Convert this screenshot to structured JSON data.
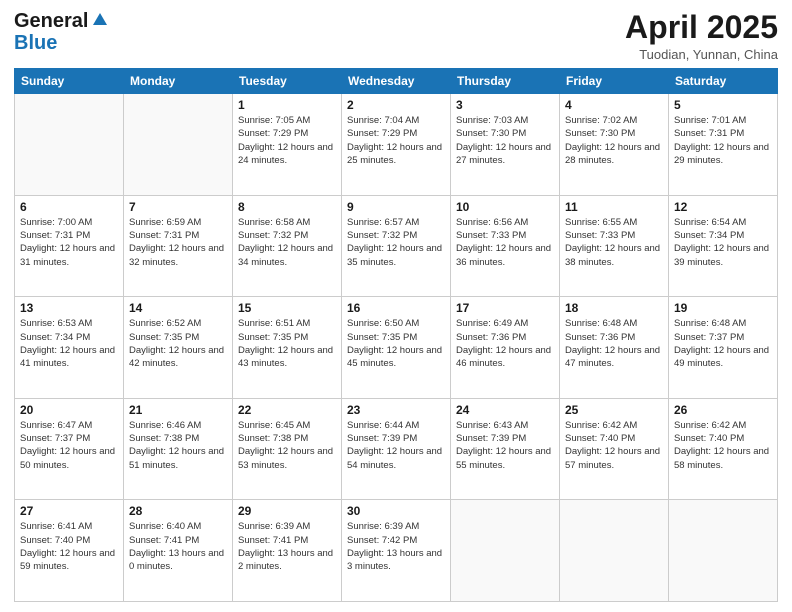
{
  "header": {
    "logo_general": "General",
    "logo_blue": "Blue",
    "title": "April 2025",
    "subtitle": "Tuodian, Yunnan, China"
  },
  "days_of_week": [
    "Sunday",
    "Monday",
    "Tuesday",
    "Wednesday",
    "Thursday",
    "Friday",
    "Saturday"
  ],
  "weeks": [
    [
      {
        "day": "",
        "info": ""
      },
      {
        "day": "",
        "info": ""
      },
      {
        "day": "1",
        "info": "Sunrise: 7:05 AM\nSunset: 7:29 PM\nDaylight: 12 hours and 24 minutes."
      },
      {
        "day": "2",
        "info": "Sunrise: 7:04 AM\nSunset: 7:29 PM\nDaylight: 12 hours and 25 minutes."
      },
      {
        "day": "3",
        "info": "Sunrise: 7:03 AM\nSunset: 7:30 PM\nDaylight: 12 hours and 27 minutes."
      },
      {
        "day": "4",
        "info": "Sunrise: 7:02 AM\nSunset: 7:30 PM\nDaylight: 12 hours and 28 minutes."
      },
      {
        "day": "5",
        "info": "Sunrise: 7:01 AM\nSunset: 7:31 PM\nDaylight: 12 hours and 29 minutes."
      }
    ],
    [
      {
        "day": "6",
        "info": "Sunrise: 7:00 AM\nSunset: 7:31 PM\nDaylight: 12 hours and 31 minutes."
      },
      {
        "day": "7",
        "info": "Sunrise: 6:59 AM\nSunset: 7:31 PM\nDaylight: 12 hours and 32 minutes."
      },
      {
        "day": "8",
        "info": "Sunrise: 6:58 AM\nSunset: 7:32 PM\nDaylight: 12 hours and 34 minutes."
      },
      {
        "day": "9",
        "info": "Sunrise: 6:57 AM\nSunset: 7:32 PM\nDaylight: 12 hours and 35 minutes."
      },
      {
        "day": "10",
        "info": "Sunrise: 6:56 AM\nSunset: 7:33 PM\nDaylight: 12 hours and 36 minutes."
      },
      {
        "day": "11",
        "info": "Sunrise: 6:55 AM\nSunset: 7:33 PM\nDaylight: 12 hours and 38 minutes."
      },
      {
        "day": "12",
        "info": "Sunrise: 6:54 AM\nSunset: 7:34 PM\nDaylight: 12 hours and 39 minutes."
      }
    ],
    [
      {
        "day": "13",
        "info": "Sunrise: 6:53 AM\nSunset: 7:34 PM\nDaylight: 12 hours and 41 minutes."
      },
      {
        "day": "14",
        "info": "Sunrise: 6:52 AM\nSunset: 7:35 PM\nDaylight: 12 hours and 42 minutes."
      },
      {
        "day": "15",
        "info": "Sunrise: 6:51 AM\nSunset: 7:35 PM\nDaylight: 12 hours and 43 minutes."
      },
      {
        "day": "16",
        "info": "Sunrise: 6:50 AM\nSunset: 7:35 PM\nDaylight: 12 hours and 45 minutes."
      },
      {
        "day": "17",
        "info": "Sunrise: 6:49 AM\nSunset: 7:36 PM\nDaylight: 12 hours and 46 minutes."
      },
      {
        "day": "18",
        "info": "Sunrise: 6:48 AM\nSunset: 7:36 PM\nDaylight: 12 hours and 47 minutes."
      },
      {
        "day": "19",
        "info": "Sunrise: 6:48 AM\nSunset: 7:37 PM\nDaylight: 12 hours and 49 minutes."
      }
    ],
    [
      {
        "day": "20",
        "info": "Sunrise: 6:47 AM\nSunset: 7:37 PM\nDaylight: 12 hours and 50 minutes."
      },
      {
        "day": "21",
        "info": "Sunrise: 6:46 AM\nSunset: 7:38 PM\nDaylight: 12 hours and 51 minutes."
      },
      {
        "day": "22",
        "info": "Sunrise: 6:45 AM\nSunset: 7:38 PM\nDaylight: 12 hours and 53 minutes."
      },
      {
        "day": "23",
        "info": "Sunrise: 6:44 AM\nSunset: 7:39 PM\nDaylight: 12 hours and 54 minutes."
      },
      {
        "day": "24",
        "info": "Sunrise: 6:43 AM\nSunset: 7:39 PM\nDaylight: 12 hours and 55 minutes."
      },
      {
        "day": "25",
        "info": "Sunrise: 6:42 AM\nSunset: 7:40 PM\nDaylight: 12 hours and 57 minutes."
      },
      {
        "day": "26",
        "info": "Sunrise: 6:42 AM\nSunset: 7:40 PM\nDaylight: 12 hours and 58 minutes."
      }
    ],
    [
      {
        "day": "27",
        "info": "Sunrise: 6:41 AM\nSunset: 7:40 PM\nDaylight: 12 hours and 59 minutes."
      },
      {
        "day": "28",
        "info": "Sunrise: 6:40 AM\nSunset: 7:41 PM\nDaylight: 13 hours and 0 minutes."
      },
      {
        "day": "29",
        "info": "Sunrise: 6:39 AM\nSunset: 7:41 PM\nDaylight: 13 hours and 2 minutes."
      },
      {
        "day": "30",
        "info": "Sunrise: 6:39 AM\nSunset: 7:42 PM\nDaylight: 13 hours and 3 minutes."
      },
      {
        "day": "",
        "info": ""
      },
      {
        "day": "",
        "info": ""
      },
      {
        "day": "",
        "info": ""
      }
    ]
  ]
}
